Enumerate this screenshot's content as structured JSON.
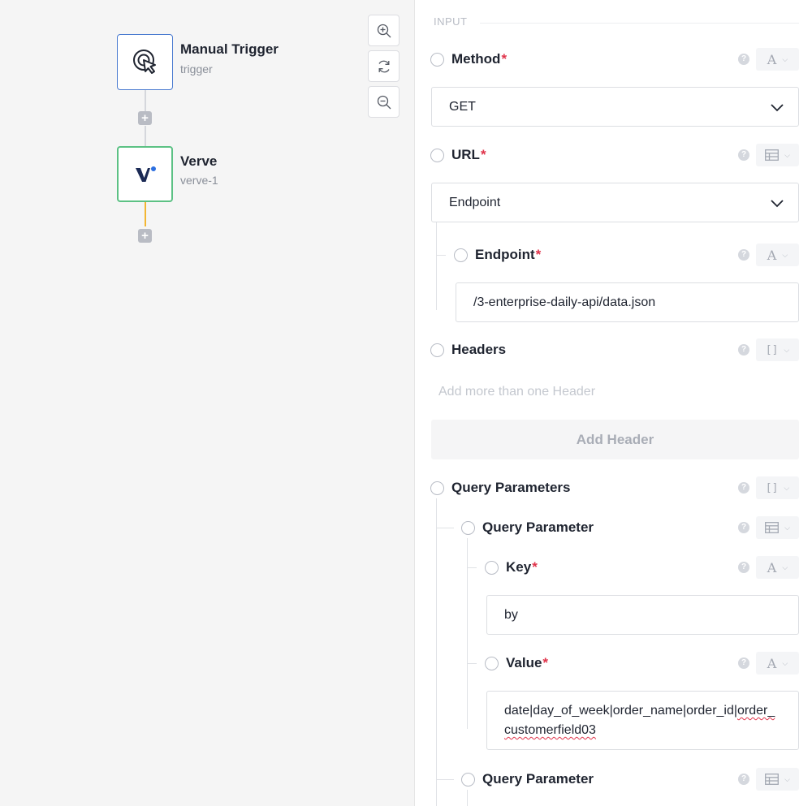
{
  "canvas": {
    "nodes": [
      {
        "title": "Manual Trigger",
        "subtitle": "trigger",
        "icon": "pointer-click-icon"
      },
      {
        "title": "Verve",
        "subtitle": "verve-1",
        "icon": "verve-logo-icon"
      }
    ],
    "add_glyph": "+",
    "zoom_controls": [
      "zoom-in-icon",
      "refresh-icon",
      "zoom-out-icon"
    ]
  },
  "colors": {
    "trigger_border": "#4a7bd0",
    "verve_border": "#5cc184",
    "active_connector": "#f2b632",
    "required_marker": "#e0334a",
    "verve_logo": "#1b2a55",
    "verve_dot": "#2c6fe0"
  },
  "form": {
    "section": "INPUT",
    "required_marker": "*",
    "help_glyph": "?",
    "method": {
      "label": "Method",
      "value": "GET",
      "type": "A"
    },
    "url": {
      "label": "URL",
      "value": "Endpoint",
      "type": "table-icon"
    },
    "endpoint": {
      "label": "Endpoint",
      "value": "/3-enterprise-daily-api/data.json",
      "type": "A"
    },
    "headers": {
      "label": "Headers",
      "hint": "Add more than one Header",
      "add_button": "Add Header",
      "type": "[]"
    },
    "query_parameters": {
      "label": "Query Parameters",
      "type": "[]",
      "items": [
        {
          "label": "Query Parameter",
          "type": "table-icon",
          "key": {
            "label": "Key",
            "value": "by",
            "type": "A"
          },
          "value": {
            "label": "Value",
            "value_part1": "date|day_of_week|order_name|order_id|",
            "value_part2": "order_customerfield03",
            "type": "A"
          }
        },
        {
          "label": "Query Parameter",
          "type": "table-icon"
        }
      ]
    }
  }
}
